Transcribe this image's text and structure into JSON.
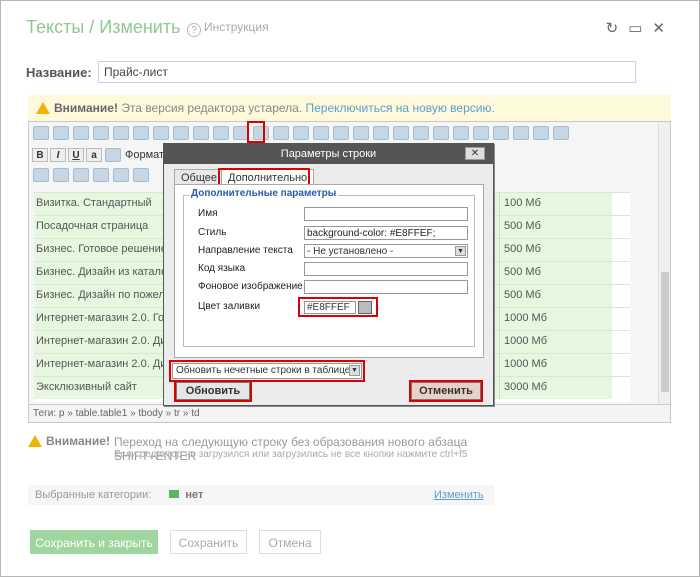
{
  "header": {
    "title": "Тексты / Изменить",
    "help": "Инструкция"
  },
  "form": {
    "name_label": "Название:",
    "name_value": "Прайс-лист"
  },
  "warning": {
    "bold": "Внимание!",
    "text": " Эта версия редактора устарела. ",
    "link": "Переключиться на новую версию."
  },
  "toolbar": {
    "format_label": "Формат"
  },
  "table_rows": [
    {
      "name": "Визитка. Стандартный",
      "size": "100 Мб"
    },
    {
      "name": "Посадочная страница",
      "size": "500 Мб"
    },
    {
      "name": "Бизнес. Готовое решение",
      "size": "500 Мб"
    },
    {
      "name": "Бизнес. Дизайн из каталога",
      "size": "500 Мб"
    },
    {
      "name": "Бизнес. Дизайн по пожеланиям",
      "size": "500 Мб"
    },
    {
      "name": "Интернет-магазин 2.0. Готовое решение",
      "size": "1000 Мб"
    },
    {
      "name": "Интернет-магазин 2.0. Дизайн из каталога",
      "size": "1000 Мб"
    },
    {
      "name": "Интернет-магазин 2.0. Дизайн по пожеланиям",
      "size": "1000 Мб"
    },
    {
      "name": "Эксклюзивный сайт",
      "size": "3000 Мб"
    }
  ],
  "statusbar": "Теги: p » table.table1 » tbody » tr » td",
  "warning2": {
    "bold": "Внимание!",
    "line1": "Переход на следующую строку без образования нового абзаца SHIFT+ENTER",
    "line2": "Если редактор не загрузился или загрузились не все кнопки нажмите ctrl+f5"
  },
  "categories": {
    "label": "Выбранные категории:",
    "value": "нет",
    "change": "Изменить"
  },
  "buttons": {
    "save_close": "Сохранить и закрыть",
    "save": "Сохранить",
    "cancel": "Отмена"
  },
  "dialog": {
    "title": "Параметры строки",
    "tabs": [
      "Общее",
      "Дополнительно"
    ],
    "legend": "Дополнительные параметры",
    "fields": {
      "name_label": "Имя",
      "name_value": "",
      "style_label": "Стиль",
      "style_value": "background-color: #E8FFEF;",
      "dir_label": "Направление текста",
      "dir_value": "- Не установлено -",
      "lang_label": "Код языка",
      "lang_value": "",
      "bg_label": "Фоновое изображение",
      "bg_value": "",
      "fill_label": "Цвет заливки",
      "fill_value": "#E8FFEF"
    },
    "scope": "Обновить нечетные строки в таблице",
    "update": "Обновить",
    "cancel": "Отменить"
  },
  "colors": {
    "accent": "#8fc98f",
    "row_bg": "#e6f7e0",
    "highlight": "#dd0000"
  }
}
